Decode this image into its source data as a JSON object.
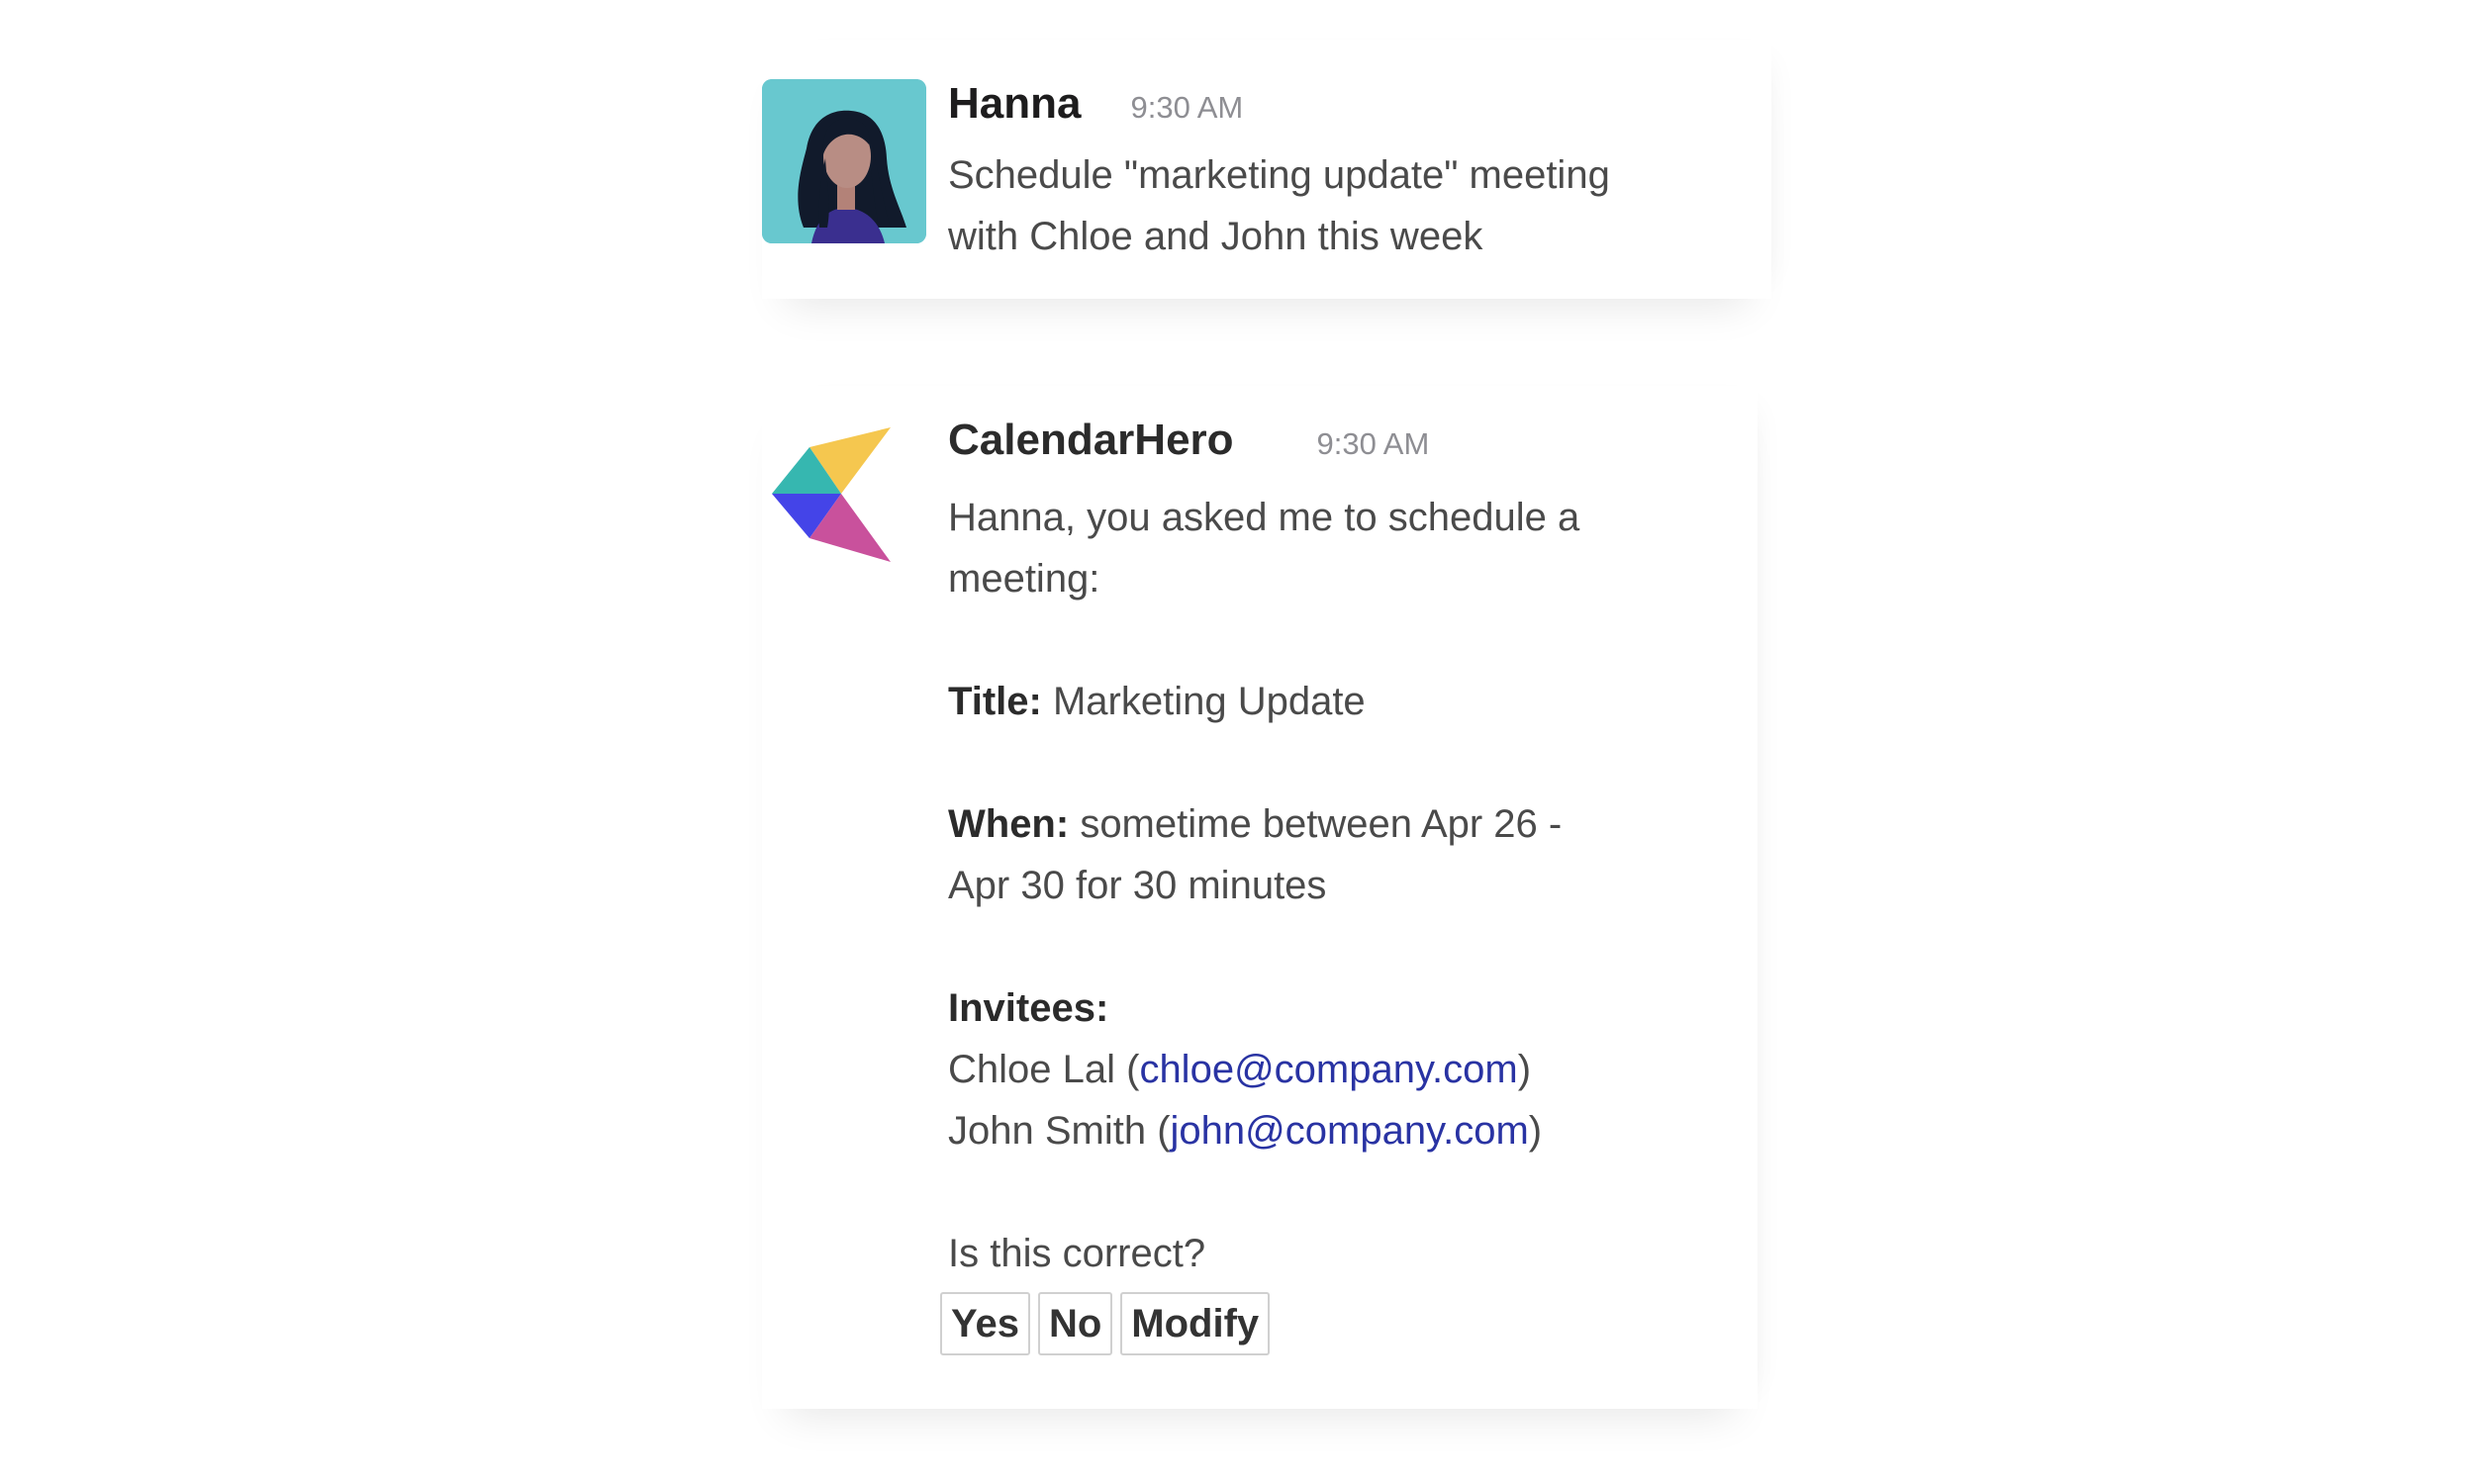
{
  "messages": [
    {
      "sender": "Hanna",
      "time": "9:30 AM",
      "avatar_icon": "woman-avatar-icon",
      "text_lines": [
        "Schedule \"marketing update\" meeting",
        "with Chloe and John this week"
      ]
    },
    {
      "sender": "CalendarHero",
      "time": "9:30 AM",
      "avatar_icon": "calendarhero-logo-icon",
      "intro_lines": [
        "Hanna, you asked me to schedule a",
        "meeting:"
      ],
      "title_label": "Title:",
      "title_value": "Marketing Update",
      "when_label": "When:",
      "when_value_line1": "sometime between Apr 26 -",
      "when_value_line2": "Apr 30 for 30 minutes",
      "invitees_label": "Invitees:",
      "invitees": [
        {
          "name": "Chloe Lal (",
          "email": "chloe@company.com",
          "close": ")"
        },
        {
          "name": "John Smith (",
          "email": "john@company.com",
          "close": ")"
        }
      ],
      "question": "Is this correct?",
      "buttons": {
        "yes": "Yes",
        "no": "No",
        "modify": "Modify"
      }
    }
  ],
  "colors": {
    "avatar_bg": "#68c8cf",
    "link": "#2933a3",
    "text": "#4a4a4a",
    "timestamp": "#8e8e93"
  }
}
